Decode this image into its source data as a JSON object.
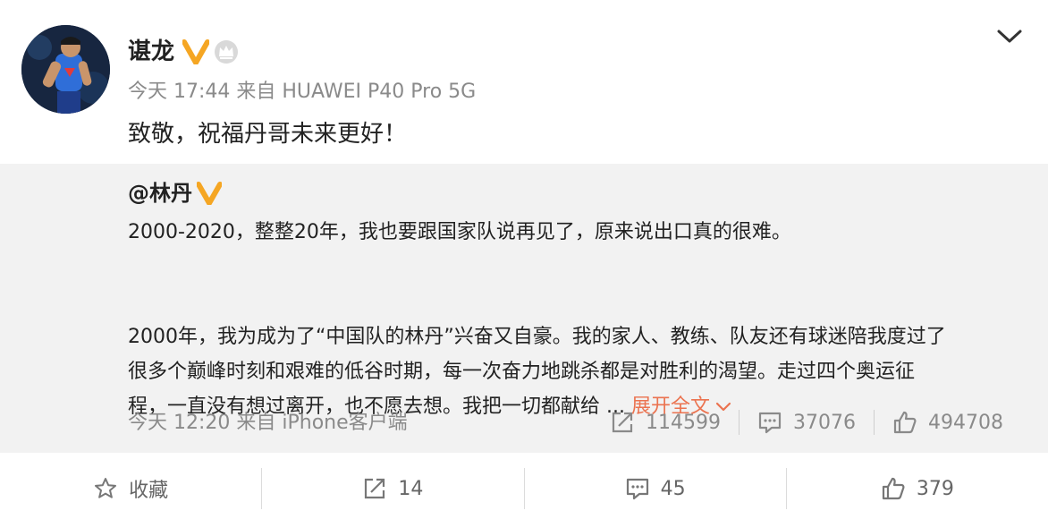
{
  "post": {
    "author": "谌龙",
    "meta": "今天 17:44 来自 HUAWEI P40 Pro 5G",
    "text": "致敬，祝福丹哥未来更好！"
  },
  "repost": {
    "author": "@林丹",
    "line1": "2000-2020，整整20年，我也要跟国家队说再见了，原来说出口真的很难。",
    "line2": "2000年，我为成为了“中国队的林丹”兴奋又自豪。我的家人、教练、队友还有球迷陪我度过了",
    "line3": "很多个巅峰时刻和艰难的低谷时期，每一次奋力地跳杀都是对胜利的渴望。走过四个奥运征",
    "line4": "程，一直没有想过离开，也不愿去想。我把一切都献给 ...",
    "expand_label": "展开全文",
    "meta": "今天 12:20 来自 iPhone客户端",
    "reposts": "114599",
    "comments": "37076",
    "likes": "494708"
  },
  "actions": {
    "favorite_label": "收藏",
    "repost_count": "14",
    "comment_count": "45",
    "like_count": "379"
  },
  "colors": {
    "accent": "#eb7350",
    "verify": "#f5a623",
    "muted": "#8a8a8a"
  }
}
